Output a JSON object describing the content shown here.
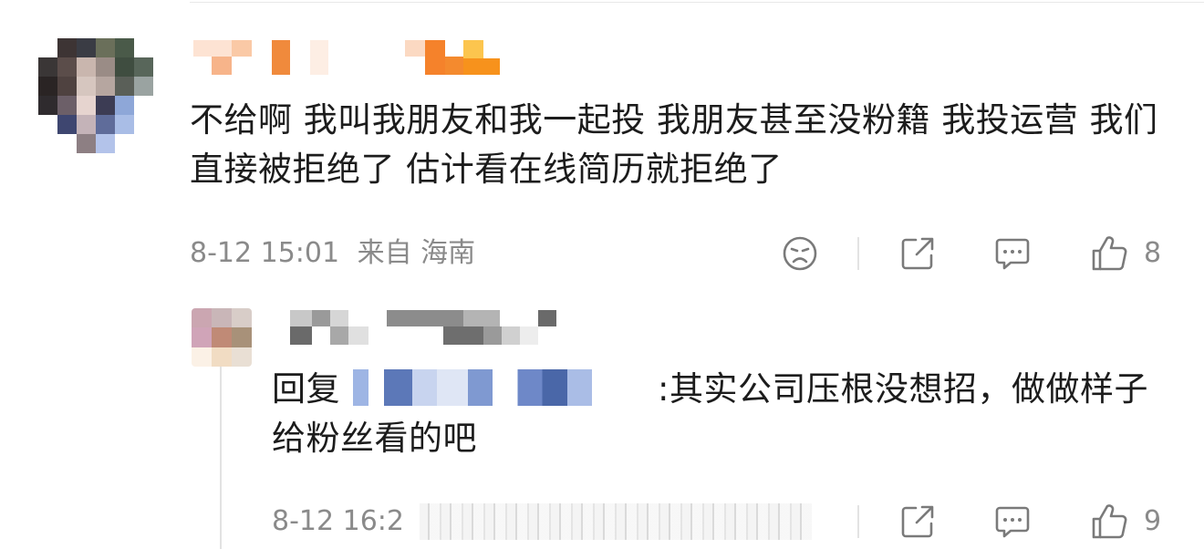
{
  "comment": {
    "text": "不给啊 我叫我朋友和我一起投 我朋友甚至没粉籍 我投运营 我们直接被拒绝了 估计看在线简历就拒绝了",
    "date": "8-12 15:01",
    "location": "来自 海南",
    "like_count": "8"
  },
  "reply": {
    "prefix": "回复",
    "text": ":其实公司压根没想招，做做样子给粉丝看的吧",
    "date": "8-12 16:2",
    "like_count": "9"
  },
  "icons": {
    "dislike": "sad-face-icon",
    "share": "share-icon",
    "comment": "comment-icon",
    "like": "thumbs-up-icon"
  },
  "colors": {
    "text": "#1c1c1c",
    "meta": "#8a8a8a",
    "icon": "#7a7a7a"
  }
}
